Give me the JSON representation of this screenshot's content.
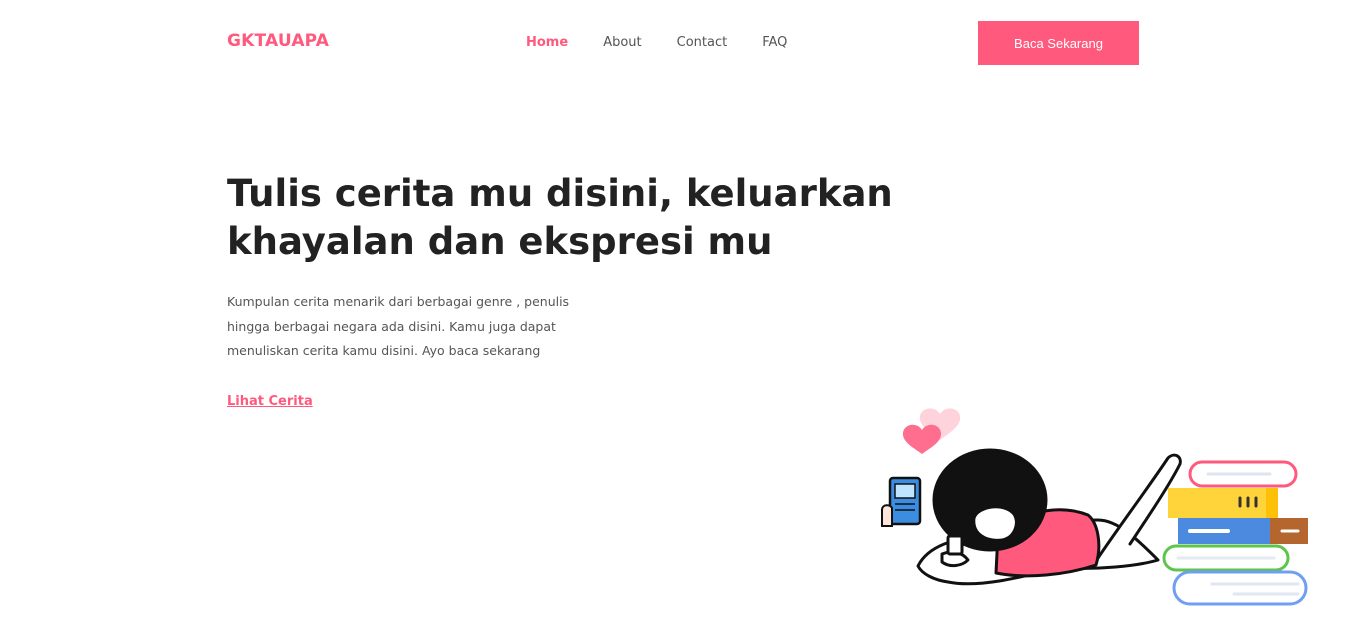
{
  "brand": {
    "name": "GKTAUAPA"
  },
  "nav": {
    "items": [
      {
        "label": "Home",
        "active": true
      },
      {
        "label": "About",
        "active": false
      },
      {
        "label": "Contact",
        "active": false
      },
      {
        "label": "FAQ",
        "active": false
      }
    ],
    "cta_label": "Baca Sekarang"
  },
  "hero": {
    "title_line1": "Tulis cerita mu disini, keluarkan",
    "title_line2": "khayalan dan ekspresi mu",
    "description": "Kumpulan cerita menarik dari berbagai genre , penulis hingga berbagai negara ada disini. Kamu juga dapat menuliskan cerita kamu disini. Ayo baca sekarang",
    "link_label": "Lihat Cerita"
  },
  "colors": {
    "accent": "#ff5a7e",
    "text_dark": "#222222",
    "text_muted": "#555555"
  }
}
